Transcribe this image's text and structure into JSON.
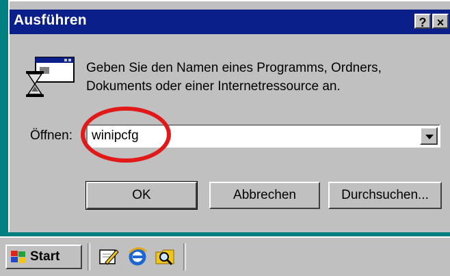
{
  "window": {
    "title": "Ausführen",
    "help_button": "?",
    "close_button": "×"
  },
  "dialog": {
    "description_line1": "Geben Sie den Namen eines Programms, Ordners,",
    "description_line2": "Dokuments oder einer Internetressource an.",
    "open_label": "Öffnen:",
    "open_value": "winipcfg",
    "icon": "run-program-icon",
    "annotation_color": "#e21919"
  },
  "buttons": {
    "ok": "OK",
    "cancel": "Abbrechen",
    "browse": "Durchsuchen..."
  },
  "taskbar": {
    "start_label": "Start",
    "quicklaunch_icons": [
      "edit-icon",
      "internet-explorer-icon",
      "explorer-icon"
    ]
  },
  "colors": {
    "title_bar": "#0b1f8a",
    "desktop": "#008080",
    "face": "#c0c0c0"
  }
}
